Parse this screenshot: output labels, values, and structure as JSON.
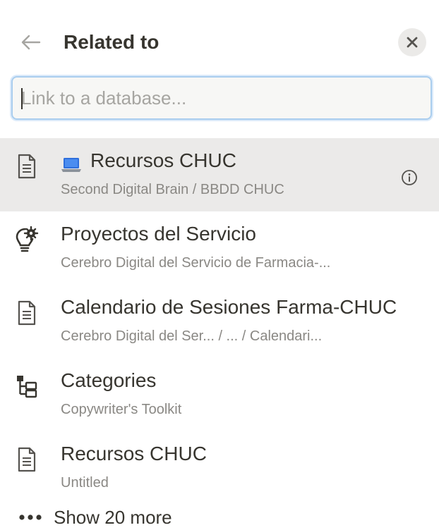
{
  "header": {
    "title": "Related to"
  },
  "search": {
    "placeholder": "Link to a database...",
    "value": ""
  },
  "items": [
    {
      "icon": "laptop-emoji-with-page-icon",
      "title": "Recursos CHUC",
      "subtitle": "Second Digital Brain / BBDD CHUC",
      "selected": true
    },
    {
      "icon": "lightbulb-gear-icon",
      "title": "Proyectos del Servicio",
      "subtitle": "Cerebro Digital del Servicio de Farmacia-..."
    },
    {
      "icon": "page-icon",
      "title": "Calendario de Sesiones Farma-CHUC",
      "subtitle": "Cerebro Digital del Ser...  / ... / Calendari..."
    },
    {
      "icon": "hierarchy-icon",
      "title": "Categories",
      "subtitle": "Copywriter's Toolkit"
    },
    {
      "icon": "page-icon",
      "title": "Recursos CHUC",
      "subtitle": "Untitled"
    }
  ],
  "show_more": {
    "label": "Show 20 more"
  },
  "colors": {
    "selected_row": "#ebeae9",
    "input_border": "#a9cdee",
    "text_primary": "#37352f",
    "text_secondary": "#8a8884"
  }
}
